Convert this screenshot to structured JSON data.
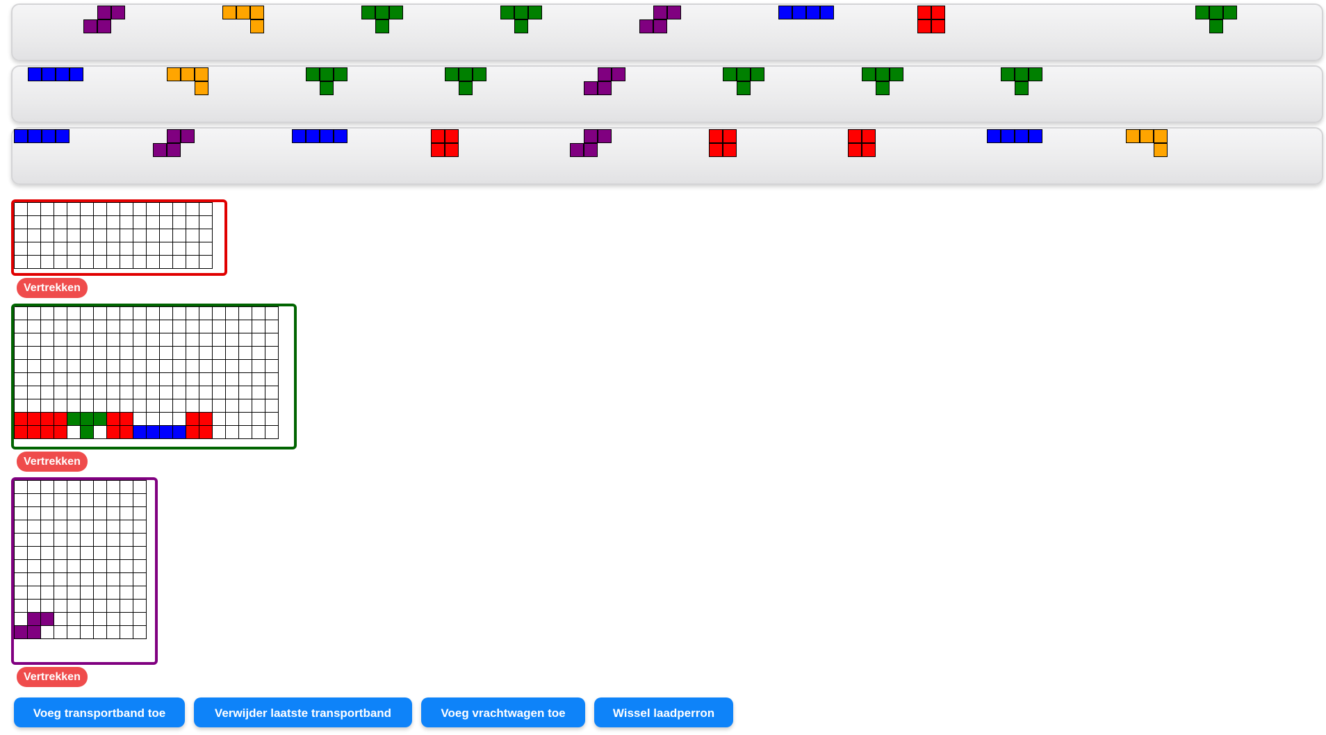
{
  "colors": {
    "purple": "#800080",
    "orange": "#ffa500",
    "green": "#008000",
    "blue": "#0000ff",
    "red": "#ff0000",
    "truck_red": "#e00000",
    "truck_green": "#006400",
    "truck_purple": "#800080",
    "button_blue": "#0e83f9",
    "depart_red": "#ef4c4c"
  },
  "shapes": {
    "S": [
      [
        1,
        0
      ],
      [
        2,
        0
      ],
      [
        0,
        1
      ],
      [
        1,
        1
      ]
    ],
    "L": [
      [
        0,
        0
      ],
      [
        1,
        0
      ],
      [
        2,
        0
      ],
      [
        2,
        1
      ]
    ],
    "T": [
      [
        0,
        0
      ],
      [
        1,
        0
      ],
      [
        2,
        0
      ],
      [
        1,
        1
      ]
    ],
    "I": [
      [
        0,
        0
      ],
      [
        1,
        0
      ],
      [
        2,
        0
      ],
      [
        3,
        0
      ]
    ],
    "O": [
      [
        0,
        0
      ],
      [
        1,
        0
      ],
      [
        0,
        1
      ],
      [
        1,
        1
      ]
    ]
  },
  "belts": [
    {
      "pieces": [
        {
          "shape": "S",
          "color": "purple"
        },
        {
          "shape": "L",
          "color": "orange"
        },
        {
          "shape": "T",
          "color": "green"
        },
        {
          "shape": "T",
          "color": "green"
        },
        {
          "shape": "S",
          "color": "purple"
        },
        {
          "shape": "I",
          "color": "blue"
        },
        {
          "shape": "O",
          "color": "red"
        },
        {
          "shape": "T",
          "color": "green"
        }
      ]
    },
    {
      "pieces": [
        {
          "shape": "I",
          "color": "blue"
        },
        {
          "shape": "L",
          "color": "orange"
        },
        {
          "shape": "T",
          "color": "green"
        },
        {
          "shape": "T",
          "color": "green"
        },
        {
          "shape": "S",
          "color": "purple"
        },
        {
          "shape": "T",
          "color": "green"
        },
        {
          "shape": "T",
          "color": "green"
        },
        {
          "shape": "T",
          "color": "green"
        }
      ]
    },
    {
      "pieces": [
        {
          "shape": "I",
          "color": "blue"
        },
        {
          "shape": "S",
          "color": "purple"
        },
        {
          "shape": "I",
          "color": "blue"
        },
        {
          "shape": "O",
          "color": "red"
        },
        {
          "shape": "S",
          "color": "purple"
        },
        {
          "shape": "O",
          "color": "red"
        },
        {
          "shape": "O",
          "color": "red"
        },
        {
          "shape": "I",
          "color": "blue"
        },
        {
          "shape": "L",
          "color": "orange"
        }
      ]
    }
  ],
  "trucks": [
    {
      "name": "red",
      "border": "truck_red",
      "cols": 15,
      "rows": 5,
      "filled": [],
      "depart_label": "Vertrekken"
    },
    {
      "name": "green",
      "border": "truck_green",
      "cols": 20,
      "rows": 10,
      "filled": [
        [
          0,
          8,
          "red"
        ],
        [
          1,
          8,
          "red"
        ],
        [
          2,
          8,
          "red"
        ],
        [
          3,
          8,
          "red"
        ],
        [
          0,
          9,
          "red"
        ],
        [
          1,
          9,
          "red"
        ],
        [
          2,
          9,
          "red"
        ],
        [
          3,
          9,
          "red"
        ],
        [
          4,
          8,
          "green"
        ],
        [
          5,
          8,
          "green"
        ],
        [
          6,
          8,
          "green"
        ],
        [
          5,
          9,
          "green"
        ],
        [
          7,
          8,
          "red"
        ],
        [
          8,
          8,
          "red"
        ],
        [
          7,
          9,
          "red"
        ],
        [
          8,
          9,
          "red"
        ],
        [
          9,
          9,
          "blue"
        ],
        [
          10,
          9,
          "blue"
        ],
        [
          11,
          9,
          "blue"
        ],
        [
          12,
          9,
          "blue"
        ],
        [
          13,
          8,
          "red"
        ],
        [
          14,
          8,
          "red"
        ],
        [
          13,
          9,
          "red"
        ],
        [
          14,
          9,
          "red"
        ]
      ],
      "depart_label": "Vertrekken"
    },
    {
      "name": "purple",
      "border": "truck_purple",
      "cols": 10,
      "rows": 12,
      "filled": [
        [
          1,
          10,
          "purple"
        ],
        [
          2,
          10,
          "purple"
        ],
        [
          0,
          11,
          "purple"
        ],
        [
          1,
          11,
          "purple"
        ]
      ],
      "depart_label": "Vertrekken"
    }
  ],
  "actions": {
    "add_belt": "Voeg transportband toe",
    "remove_belt": "Verwijder laatste transportband",
    "add_truck": "Voeg vrachtwagen toe",
    "switch_dock": "Wissel laadperron"
  }
}
